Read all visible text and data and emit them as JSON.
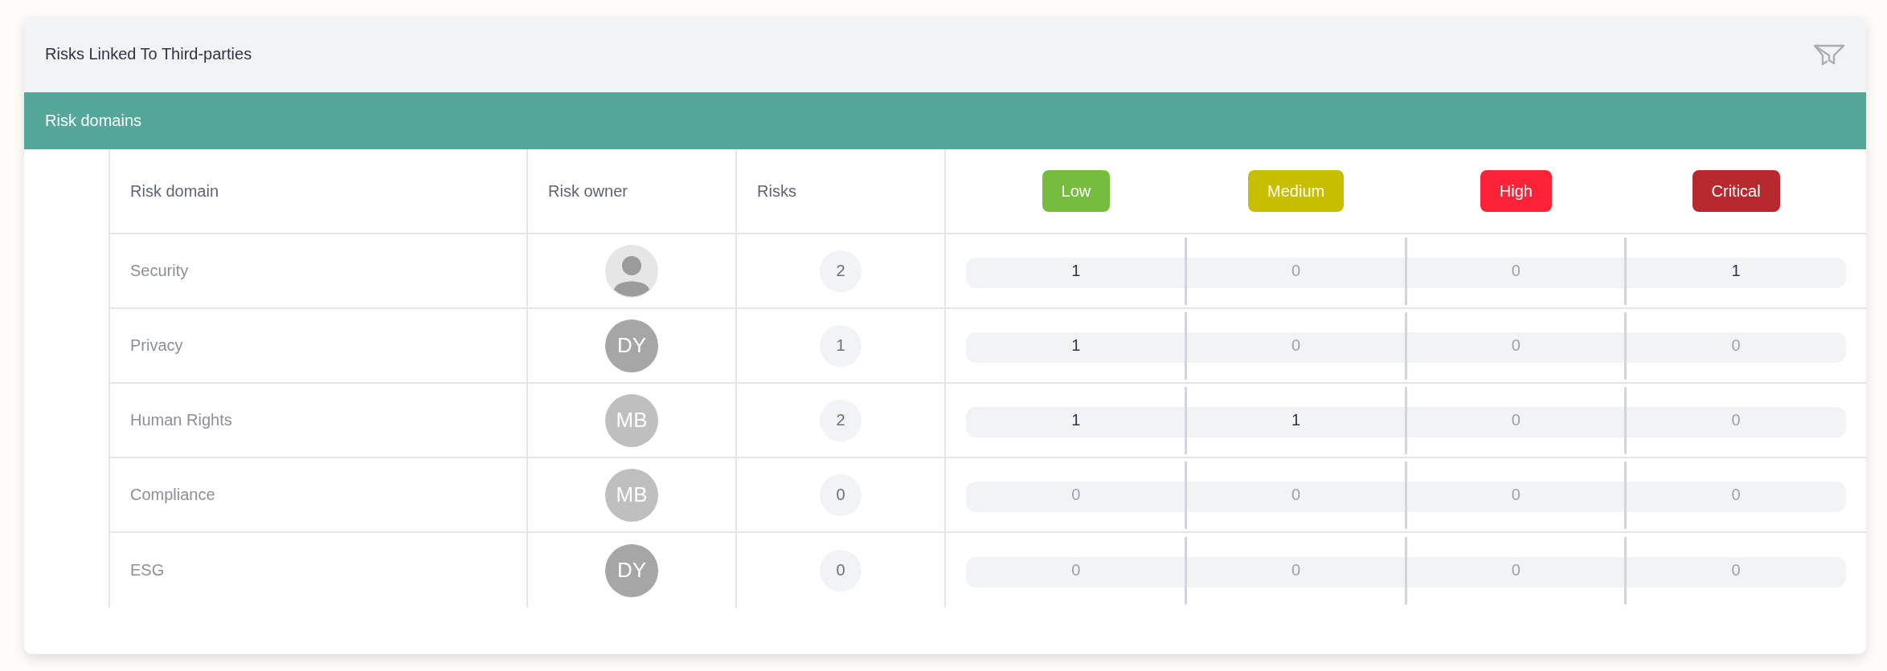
{
  "panel": {
    "title": "Risks Linked To Third-parties"
  },
  "section": {
    "title": "Risk domains"
  },
  "table": {
    "columns": [
      "Risk domain",
      "Risk owner",
      "Risks"
    ],
    "levels": [
      {
        "label": "Low",
        "color": "#76bc3f"
      },
      {
        "label": "Medium",
        "color": "#c8be00"
      },
      {
        "label": "High",
        "color": "#fa2337"
      },
      {
        "label": "Critical",
        "color": "#b8292f"
      }
    ],
    "rows": [
      {
        "domain": "Security",
        "owner": {
          "kind": "photo"
        },
        "risks": "2",
        "counts": [
          {
            "value": "1",
            "dim": false
          },
          {
            "value": "0",
            "dim": true
          },
          {
            "value": "0",
            "dim": true
          },
          {
            "value": "1",
            "dim": false
          }
        ]
      },
      {
        "domain": "Privacy",
        "owner": {
          "kind": "initials",
          "initials": "DY",
          "color": "#a6a6a6"
        },
        "risks": "1",
        "counts": [
          {
            "value": "1",
            "dim": false
          },
          {
            "value": "0",
            "dim": true
          },
          {
            "value": "0",
            "dim": true
          },
          {
            "value": "0",
            "dim": true
          }
        ]
      },
      {
        "domain": "Human Rights",
        "owner": {
          "kind": "initials",
          "initials": "MB",
          "color": "#bfbfbf"
        },
        "risks": "2",
        "counts": [
          {
            "value": "1",
            "dim": false
          },
          {
            "value": "1",
            "dim": false
          },
          {
            "value": "0",
            "dim": true
          },
          {
            "value": "0",
            "dim": true
          }
        ]
      },
      {
        "domain": "Compliance",
        "owner": {
          "kind": "initials",
          "initials": "MB",
          "color": "#bfbfbf"
        },
        "risks": "0",
        "counts": [
          {
            "value": "0",
            "dim": true
          },
          {
            "value": "0",
            "dim": true
          },
          {
            "value": "0",
            "dim": true
          },
          {
            "value": "0",
            "dim": true
          }
        ]
      },
      {
        "domain": "ESG",
        "owner": {
          "kind": "initials",
          "initials": "DY",
          "color": "#a6a6a6"
        },
        "risks": "0",
        "counts": [
          {
            "value": "0",
            "dim": true
          },
          {
            "value": "0",
            "dim": true
          },
          {
            "value": "0",
            "dim": true
          },
          {
            "value": "0",
            "dim": true
          }
        ]
      }
    ]
  }
}
